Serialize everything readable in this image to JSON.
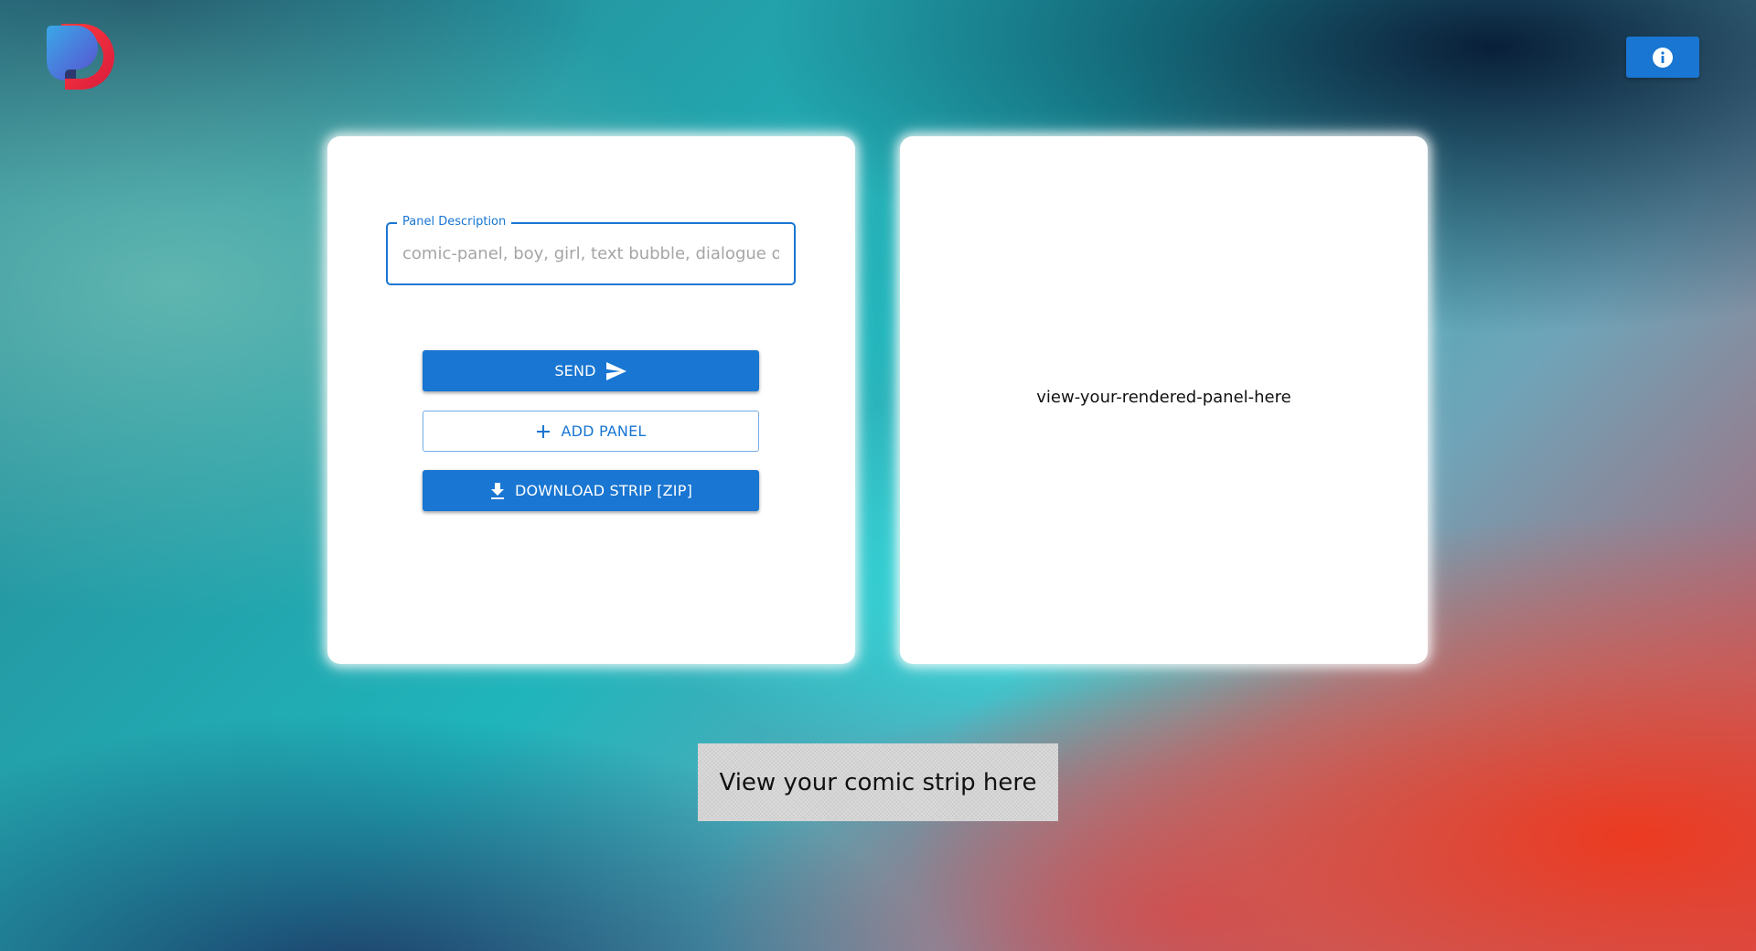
{
  "header": {
    "logo_icon": "app-logo-icon",
    "info_button_icon": "info-icon",
    "accent_color": "#1976d2"
  },
  "editor": {
    "panel_description": {
      "label": "Panel Description",
      "placeholder": "comic-panel, boy, girl, text bubble, dialogue of boy",
      "value": ""
    },
    "send_label": "SEND",
    "send_icon": "send-icon",
    "add_panel_label": "ADD PANEL",
    "add_panel_icon": "plus-icon",
    "download_label": "DOWNLOAD STRIP [ZIP]",
    "download_icon": "download-icon"
  },
  "preview": {
    "placeholder_text": "view-your-rendered-panel-here"
  },
  "strip": {
    "label": "View your comic strip here"
  }
}
